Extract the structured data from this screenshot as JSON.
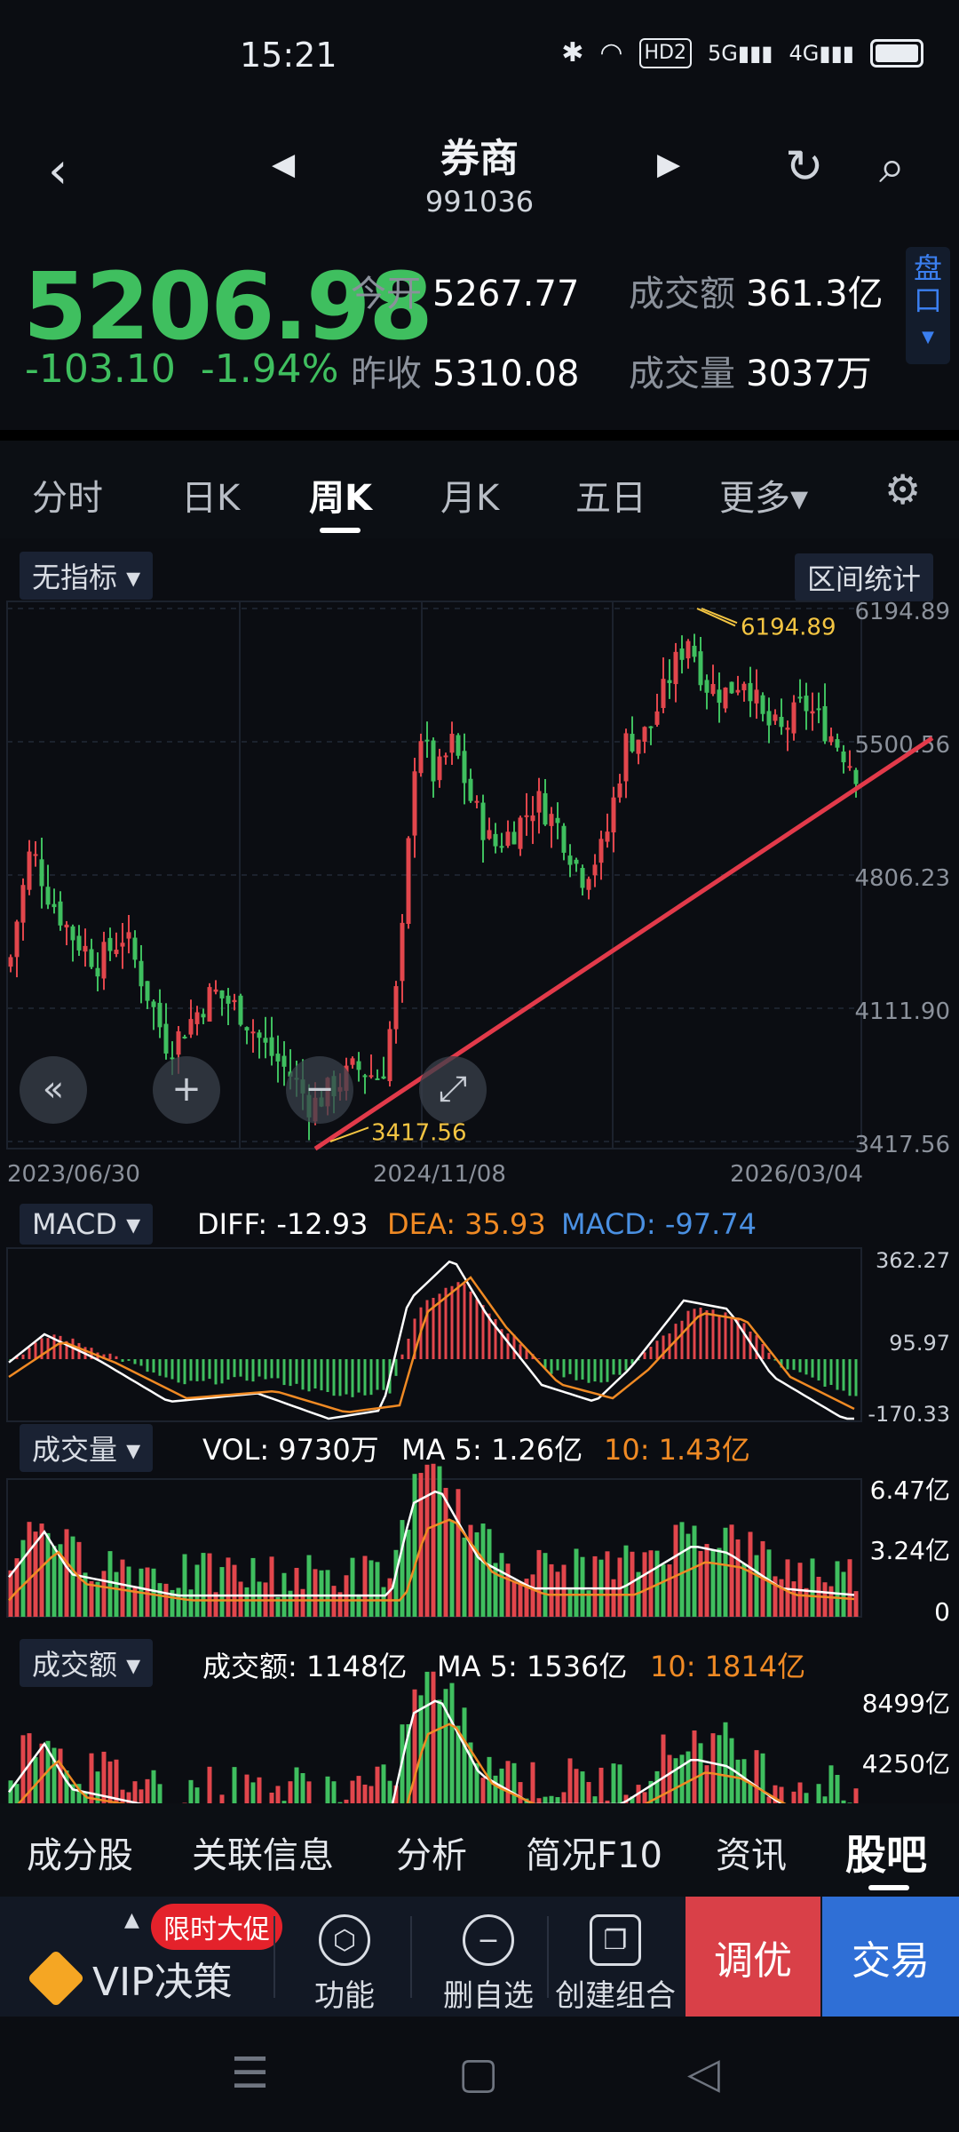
{
  "status": {
    "time": "15:21",
    "network": "5G",
    "network2": "4G",
    "hd": "HD2"
  },
  "header": {
    "name": "券商",
    "code": "991036"
  },
  "quote": {
    "price": "5206.98",
    "change": "-103.10",
    "change_pct": "-1.94%",
    "open_label": "今开",
    "open": "5267.77",
    "prev_label": "昨收",
    "prev": "5310.08",
    "amount_label": "成交额",
    "amount": "361.3亿",
    "volume_label": "成交量",
    "volume": "3037万",
    "pankou_label": "盘口"
  },
  "tabs": [
    {
      "label": "分时"
    },
    {
      "label": "日K"
    },
    {
      "label": "周K"
    },
    {
      "label": "月K"
    },
    {
      "label": "五日"
    },
    {
      "label": "更多▾"
    }
  ],
  "indicator_btn": "无指标 ▾",
  "stats_btn": "区间统计",
  "kline": {
    "y_ticks": [
      "6194.89",
      "5500.56",
      "4806.23",
      "4111.90",
      "3417.56"
    ],
    "x_ticks": [
      "2023/06/30",
      "2024/11/08",
      "2026/03/04"
    ],
    "high_label": "6194.89",
    "low_label": "3417.56"
  },
  "macd": {
    "btn": "MACD ▾",
    "diff": "DIFF: -12.93",
    "dea": "DEA: 35.93",
    "macd": "MACD: -97.74",
    "ticks": [
      "362.27",
      "95.97",
      "-170.33"
    ]
  },
  "vol": {
    "btn": "成交量 ▾",
    "vol": "VOL: 9730万",
    "ma5": "MA 5: 1.26亿",
    "ma10": "10: 1.43亿",
    "ticks": [
      "6.47亿",
      "3.24亿",
      "0"
    ]
  },
  "amount": {
    "btn": "成交额 ▾",
    "amt": "成交额: 1148亿",
    "ma5": "MA 5: 1536亿",
    "ma10": "10: 1814亿",
    "ticks": [
      "8499亿",
      "4250亿"
    ]
  },
  "bottom_tabs": [
    {
      "label": "成分股"
    },
    {
      "label": "关联信息"
    },
    {
      "label": "分析"
    },
    {
      "label": "简况F10"
    },
    {
      "label": "资讯"
    },
    {
      "label": "股吧"
    }
  ],
  "toolbar": {
    "promo": "限时大促",
    "vip": "VIP决策",
    "func": "功能",
    "remove": "删自选",
    "combo": "创建组合",
    "tune": "调优",
    "trade": "交易"
  },
  "colors": {
    "up": "#e2464c",
    "down": "#3fbf5f",
    "accent": "#2f6fd6",
    "yellow": "#f4c542",
    "orange": "#f08a24",
    "blue": "#4a90e2"
  },
  "chart_data": {
    "type": "candlestick",
    "x": [
      "2023/06/30",
      "2024/11/08",
      "2026/03/04"
    ],
    "ylim": [
      3417.56,
      6194.89
    ],
    "high": 6194.89,
    "low": 3417.56,
    "trendline": true
  }
}
